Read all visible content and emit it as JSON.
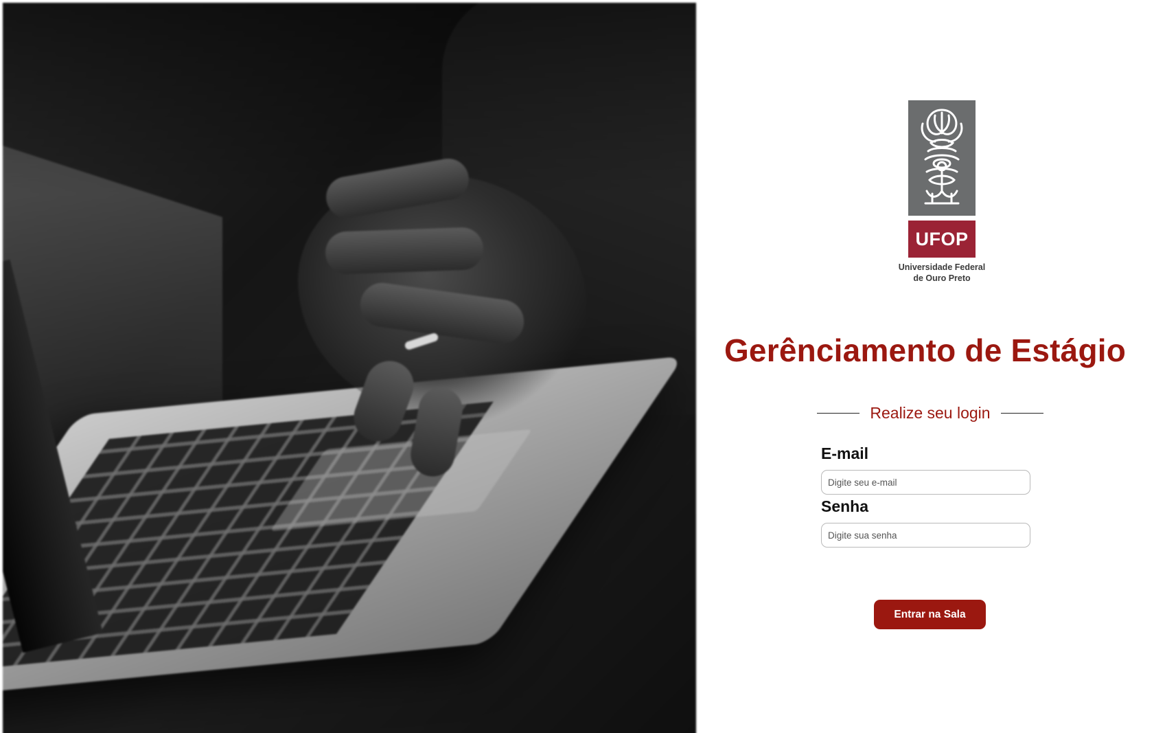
{
  "logo": {
    "acronym": "UFOP",
    "caption_line1": "Universidade Federal",
    "caption_line2": "de Ouro Preto",
    "emblem_icon": "ornamental-palmette-emblem-icon"
  },
  "title": "Gerênciamento de Estágio",
  "subtitle": "Realize seu login",
  "form": {
    "email_label": "E-mail",
    "email_placeholder": "Digite seu e-mail",
    "password_label": "Senha",
    "password_placeholder": "Digite sua senha",
    "submit_label": "Entrar na Sala"
  },
  "colors": {
    "accent": "#9b1810",
    "logo_red": "#9b2335",
    "logo_gray": "#6b6d6e"
  }
}
